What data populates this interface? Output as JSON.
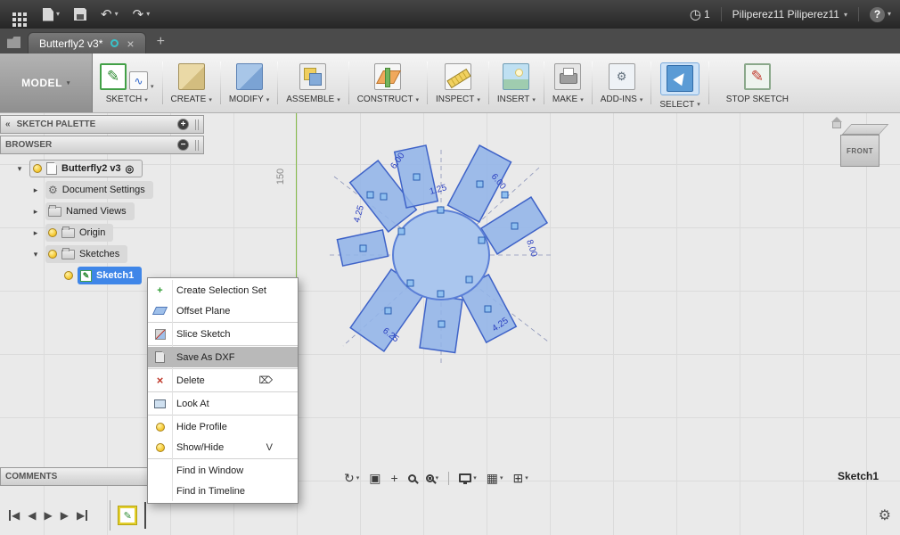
{
  "topbar": {
    "notifications": "1",
    "user": "Piliperez11 Piliperez11",
    "help": "?"
  },
  "tabs": {
    "active": "Butterfly2 v3*"
  },
  "ribbon": {
    "workspace": "MODEL",
    "items": [
      {
        "label": "SKETCH"
      },
      {
        "label": "CREATE"
      },
      {
        "label": "MODIFY"
      },
      {
        "label": "ASSEMBLE"
      },
      {
        "label": "CONSTRUCT"
      },
      {
        "label": "INSPECT"
      },
      {
        "label": "INSERT"
      },
      {
        "label": "MAKE"
      },
      {
        "label": "ADD-INS"
      },
      {
        "label": "SELECT"
      }
    ],
    "stop_sketch": "STOP SKETCH"
  },
  "panels": {
    "sketch_palette": "SKETCH PALETTE",
    "browser": "BROWSER",
    "comments": "COMMENTS"
  },
  "browser": {
    "items": [
      {
        "label": "Butterfly2 v3"
      },
      {
        "label": "Document Settings"
      },
      {
        "label": "Named Views"
      },
      {
        "label": "Origin"
      },
      {
        "label": "Sketches"
      },
      {
        "label": "Sketch1"
      }
    ]
  },
  "context_menu": {
    "items": [
      {
        "label": "Create Selection Set"
      },
      {
        "label": "Offset Plane"
      },
      {
        "label": "Slice Sketch"
      },
      {
        "label": "Save As DXF"
      },
      {
        "label": "Delete",
        "shortcut": "⌦"
      },
      {
        "label": "Look At"
      },
      {
        "label": "Hide Profile"
      },
      {
        "label": "Show/Hide",
        "shortcut": "V"
      },
      {
        "label": "Find in Window"
      },
      {
        "label": "Find in Timeline"
      }
    ]
  },
  "canvas": {
    "ruler_label": "150",
    "viewcube_face": "FRONT",
    "status_label": "Sketch1",
    "dimension_labels": [
      "6.00",
      "6.00",
      "4.25",
      "8.00",
      "1.25",
      "6.25",
      "4.25"
    ]
  }
}
